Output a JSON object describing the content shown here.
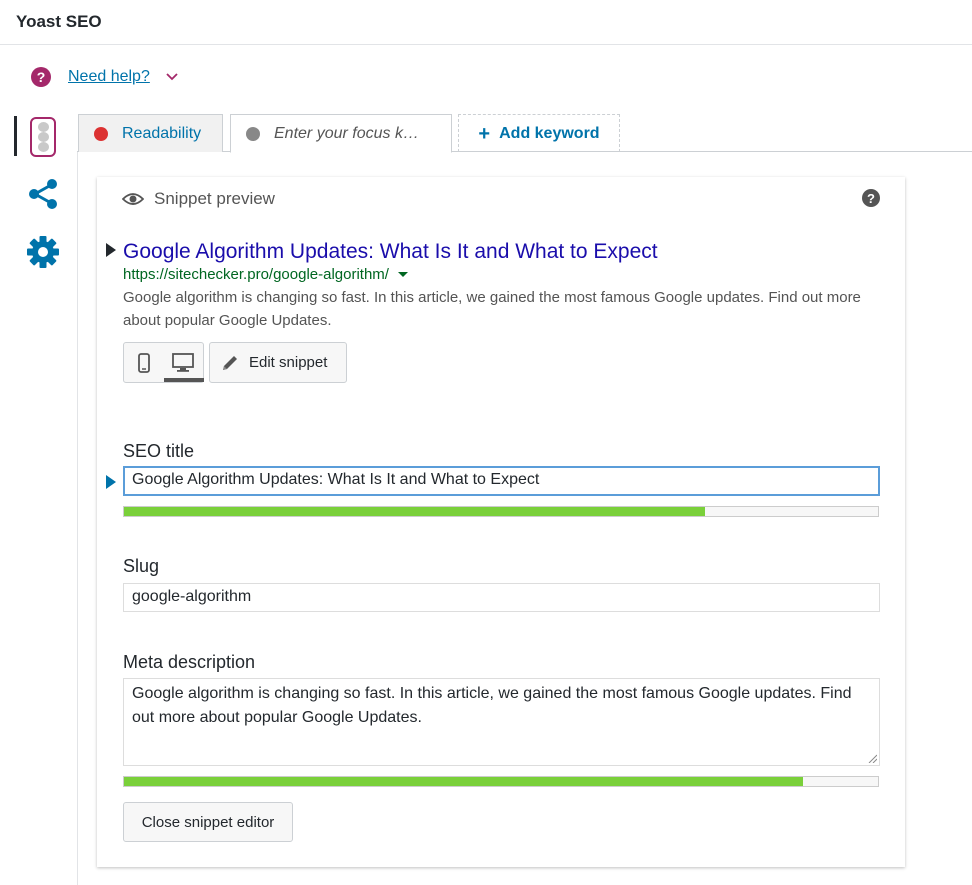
{
  "panel": {
    "title": "Yoast SEO"
  },
  "help": {
    "link_label": "Need help?"
  },
  "tabs": [
    {
      "label": "Readability",
      "status_color": "#dc3232"
    },
    {
      "label": "Enter your focus k…",
      "status_color": "#888888"
    },
    {
      "label": "Add keyword"
    }
  ],
  "snippet": {
    "header": "Snippet preview",
    "google_title": "Google Algorithm Updates: What Is It and What to Expect",
    "google_url": "https://sitechecker.pro/google-algorithm/",
    "google_description": "Google algorithm is changing so fast. In this article, we gained the most famous Google updates. Find out more about popular Google Updates.",
    "edit_button": "Edit snippet"
  },
  "fields": {
    "seo_title_label": "SEO title",
    "seo_title_value": "Google Algorithm Updates: What Is It and What to Expect",
    "seo_title_progress": 0.77,
    "slug_label": "Slug",
    "slug_value": "google-algorithm",
    "meta_label": "Meta description",
    "meta_value": "Google algorithm is changing so fast. In this article, we gained the most famous Google updates. Find out more about popular Google Updates.",
    "meta_progress": 0.9
  },
  "close_button": "Close snippet editor",
  "colors": {
    "brand": "#a4286a",
    "link": "#0073aa",
    "progress_good": "#7ad03a"
  }
}
